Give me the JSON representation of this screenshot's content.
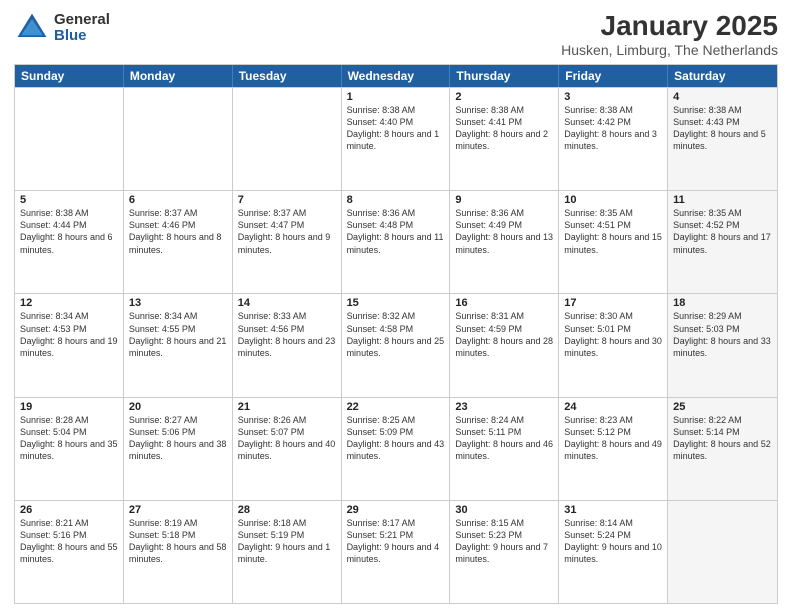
{
  "logo": {
    "general": "General",
    "blue": "Blue"
  },
  "title": "January 2025",
  "subtitle": "Husken, Limburg, The Netherlands",
  "calendar": {
    "headers": [
      "Sunday",
      "Monday",
      "Tuesday",
      "Wednesday",
      "Thursday",
      "Friday",
      "Saturday"
    ],
    "rows": [
      [
        {
          "day": "",
          "text": "",
          "shaded": false
        },
        {
          "day": "",
          "text": "",
          "shaded": false
        },
        {
          "day": "",
          "text": "",
          "shaded": false
        },
        {
          "day": "1",
          "text": "Sunrise: 8:38 AM\nSunset: 4:40 PM\nDaylight: 8 hours and 1 minute.",
          "shaded": false
        },
        {
          "day": "2",
          "text": "Sunrise: 8:38 AM\nSunset: 4:41 PM\nDaylight: 8 hours and 2 minutes.",
          "shaded": false
        },
        {
          "day": "3",
          "text": "Sunrise: 8:38 AM\nSunset: 4:42 PM\nDaylight: 8 hours and 3 minutes.",
          "shaded": false
        },
        {
          "day": "4",
          "text": "Sunrise: 8:38 AM\nSunset: 4:43 PM\nDaylight: 8 hours and 5 minutes.",
          "shaded": true
        }
      ],
      [
        {
          "day": "5",
          "text": "Sunrise: 8:38 AM\nSunset: 4:44 PM\nDaylight: 8 hours and 6 minutes.",
          "shaded": false
        },
        {
          "day": "6",
          "text": "Sunrise: 8:37 AM\nSunset: 4:46 PM\nDaylight: 8 hours and 8 minutes.",
          "shaded": false
        },
        {
          "day": "7",
          "text": "Sunrise: 8:37 AM\nSunset: 4:47 PM\nDaylight: 8 hours and 9 minutes.",
          "shaded": false
        },
        {
          "day": "8",
          "text": "Sunrise: 8:36 AM\nSunset: 4:48 PM\nDaylight: 8 hours and 11 minutes.",
          "shaded": false
        },
        {
          "day": "9",
          "text": "Sunrise: 8:36 AM\nSunset: 4:49 PM\nDaylight: 8 hours and 13 minutes.",
          "shaded": false
        },
        {
          "day": "10",
          "text": "Sunrise: 8:35 AM\nSunset: 4:51 PM\nDaylight: 8 hours and 15 minutes.",
          "shaded": false
        },
        {
          "day": "11",
          "text": "Sunrise: 8:35 AM\nSunset: 4:52 PM\nDaylight: 8 hours and 17 minutes.",
          "shaded": true
        }
      ],
      [
        {
          "day": "12",
          "text": "Sunrise: 8:34 AM\nSunset: 4:53 PM\nDaylight: 8 hours and 19 minutes.",
          "shaded": false
        },
        {
          "day": "13",
          "text": "Sunrise: 8:34 AM\nSunset: 4:55 PM\nDaylight: 8 hours and 21 minutes.",
          "shaded": false
        },
        {
          "day": "14",
          "text": "Sunrise: 8:33 AM\nSunset: 4:56 PM\nDaylight: 8 hours and 23 minutes.",
          "shaded": false
        },
        {
          "day": "15",
          "text": "Sunrise: 8:32 AM\nSunset: 4:58 PM\nDaylight: 8 hours and 25 minutes.",
          "shaded": false
        },
        {
          "day": "16",
          "text": "Sunrise: 8:31 AM\nSunset: 4:59 PM\nDaylight: 8 hours and 28 minutes.",
          "shaded": false
        },
        {
          "day": "17",
          "text": "Sunrise: 8:30 AM\nSunset: 5:01 PM\nDaylight: 8 hours and 30 minutes.",
          "shaded": false
        },
        {
          "day": "18",
          "text": "Sunrise: 8:29 AM\nSunset: 5:03 PM\nDaylight: 8 hours and 33 minutes.",
          "shaded": true
        }
      ],
      [
        {
          "day": "19",
          "text": "Sunrise: 8:28 AM\nSunset: 5:04 PM\nDaylight: 8 hours and 35 minutes.",
          "shaded": false
        },
        {
          "day": "20",
          "text": "Sunrise: 8:27 AM\nSunset: 5:06 PM\nDaylight: 8 hours and 38 minutes.",
          "shaded": false
        },
        {
          "day": "21",
          "text": "Sunrise: 8:26 AM\nSunset: 5:07 PM\nDaylight: 8 hours and 40 minutes.",
          "shaded": false
        },
        {
          "day": "22",
          "text": "Sunrise: 8:25 AM\nSunset: 5:09 PM\nDaylight: 8 hours and 43 minutes.",
          "shaded": false
        },
        {
          "day": "23",
          "text": "Sunrise: 8:24 AM\nSunset: 5:11 PM\nDaylight: 8 hours and 46 minutes.",
          "shaded": false
        },
        {
          "day": "24",
          "text": "Sunrise: 8:23 AM\nSunset: 5:12 PM\nDaylight: 8 hours and 49 minutes.",
          "shaded": false
        },
        {
          "day": "25",
          "text": "Sunrise: 8:22 AM\nSunset: 5:14 PM\nDaylight: 8 hours and 52 minutes.",
          "shaded": true
        }
      ],
      [
        {
          "day": "26",
          "text": "Sunrise: 8:21 AM\nSunset: 5:16 PM\nDaylight: 8 hours and 55 minutes.",
          "shaded": false
        },
        {
          "day": "27",
          "text": "Sunrise: 8:19 AM\nSunset: 5:18 PM\nDaylight: 8 hours and 58 minutes.",
          "shaded": false
        },
        {
          "day": "28",
          "text": "Sunrise: 8:18 AM\nSunset: 5:19 PM\nDaylight: 9 hours and 1 minute.",
          "shaded": false
        },
        {
          "day": "29",
          "text": "Sunrise: 8:17 AM\nSunset: 5:21 PM\nDaylight: 9 hours and 4 minutes.",
          "shaded": false
        },
        {
          "day": "30",
          "text": "Sunrise: 8:15 AM\nSunset: 5:23 PM\nDaylight: 9 hours and 7 minutes.",
          "shaded": false
        },
        {
          "day": "31",
          "text": "Sunrise: 8:14 AM\nSunset: 5:24 PM\nDaylight: 9 hours and 10 minutes.",
          "shaded": false
        },
        {
          "day": "",
          "text": "",
          "shaded": true
        }
      ]
    ]
  }
}
